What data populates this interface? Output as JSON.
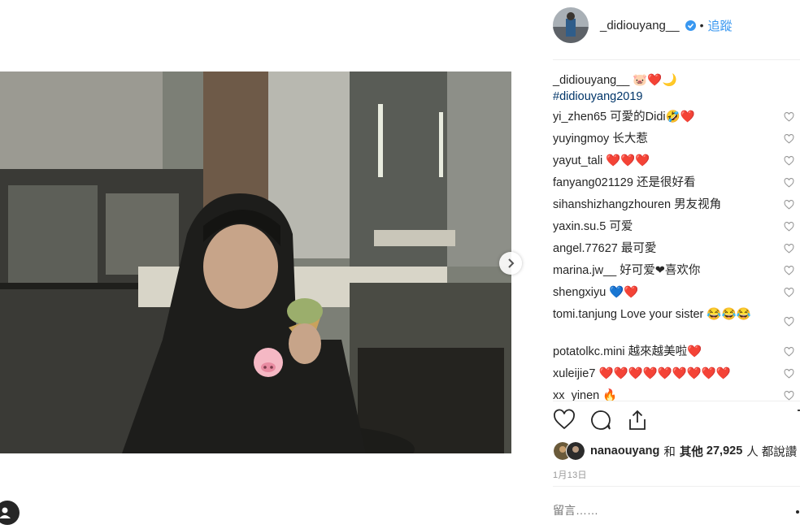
{
  "post": {
    "author": "_didiouyang__",
    "dot": "•",
    "follow_label": "追蹤",
    "caption": {
      "user": "_didiouyang__",
      "text": "🐷❤️🌙",
      "hashtag": "#didiouyang2019"
    },
    "comments": [
      {
        "user": "yi_zhen65",
        "text": "可愛的Didi🤣❤️"
      },
      {
        "user": "yuyingmoy",
        "text": "长大惹"
      },
      {
        "user": "yayut_tali",
        "text": "❤️❤️❤️"
      },
      {
        "user": "fanyang021129",
        "text": "还是很好看"
      },
      {
        "user": "sihanshizhangzhouren",
        "text": "男友视角"
      },
      {
        "user": "yaxin.su.5",
        "text": "可爱"
      },
      {
        "user": "angel.77627",
        "text": "最可愛"
      },
      {
        "user": "marina.jw__",
        "text": "好可爱❤喜欢你"
      },
      {
        "user": "shengxiyu",
        "text": "💙❤️"
      },
      {
        "user": "tomi.tanjung",
        "text": "Love your sister 😂😂😂"
      },
      {
        "user": "potatolkc.mini",
        "text": "越來越美啦❤️"
      },
      {
        "user": "xuleijie7",
        "text": "❤️❤️❤️❤️❤️❤️❤️❤️❤️"
      },
      {
        "user": "xx_yinen",
        "text": "🔥"
      }
    ],
    "likes": {
      "user": "nanaouyang",
      "and_label": "和",
      "others_label": "其他",
      "count": "27,925",
      "suffix": "人 都說讚"
    },
    "date": "1月13日",
    "comment_placeholder": "留言……"
  },
  "icons": {
    "like": "heart-icon",
    "comment": "comment-icon",
    "share": "share-icon",
    "save": "bookmark-icon",
    "next": "chevron-right-icon"
  },
  "colors": {
    "link": "#003569",
    "accent": "#3897f0",
    "text": "#262626",
    "muted": "#999999"
  }
}
